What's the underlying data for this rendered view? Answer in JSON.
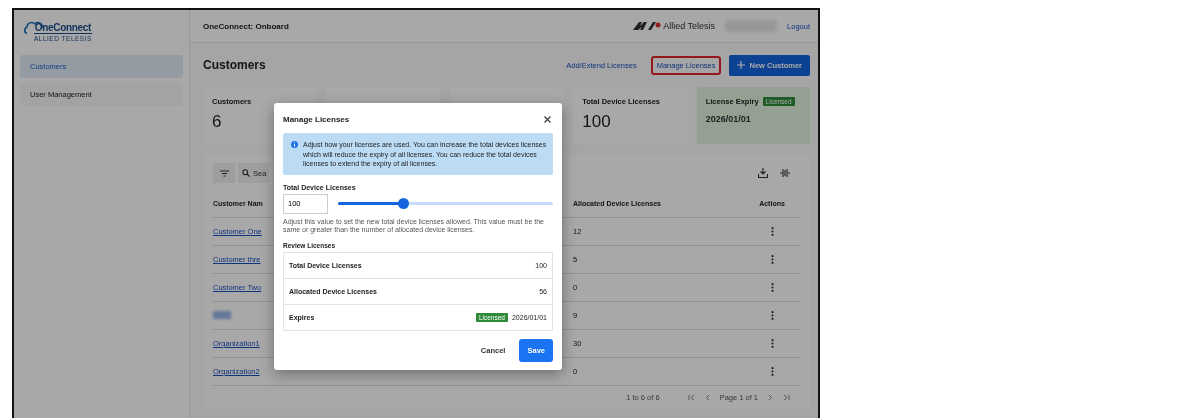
{
  "sidebar": {
    "logo": {
      "name": "OneConnect",
      "tagline": "ALLIED TELESIS"
    },
    "items": [
      {
        "label": "Customers",
        "selected": true
      },
      {
        "label": "User Management",
        "selected": false
      }
    ]
  },
  "header": {
    "title": "OneConnect: Onboard",
    "brand": "Allied Telesis",
    "logout": "Logout"
  },
  "page": {
    "title": "Customers",
    "actions": [
      {
        "kind": "link",
        "label": "Add/Extend Licenses",
        "highlighted": false
      },
      {
        "kind": "link",
        "label": "Manage Licenses",
        "highlighted": true
      },
      {
        "kind": "primary",
        "label": "New Customer"
      }
    ]
  },
  "cards": [
    {
      "kind": "plain",
      "label": "Customers",
      "value": "6"
    },
    {
      "kind": "plain"
    },
    {
      "kind": "plain"
    },
    {
      "kind": "plain",
      "label": "Total Device Licenses",
      "value": "100"
    },
    {
      "kind": "expiry",
      "label": "License Expiry",
      "badge": "Licensed",
      "value": "2026/01/01"
    }
  ],
  "table": {
    "search": {
      "placeholder": "Sea"
    },
    "columns": [
      "Customer Nam",
      "Allocated Device Licenses",
      "Actions"
    ],
    "rows": [
      {
        "name": "Customer One",
        "allocated": "12",
        "blurred": false
      },
      {
        "name": "Customer thre",
        "allocated": "5",
        "blurred": false
      },
      {
        "name": "Customer Two",
        "allocated": "0",
        "blurred": false
      },
      {
        "blurred": true,
        "allocated": "9"
      },
      {
        "name": "Organization1",
        "allocated": "30",
        "blurred": false
      },
      {
        "name": "Organization2",
        "allocated": "0",
        "blurred": false
      }
    ],
    "pagination": {
      "range": "1 to 6 of 6",
      "page": "Page 1 of 1"
    }
  },
  "dialog": {
    "title": "Manage Licenses",
    "info": "Adjust how your licenses are used. You can increase the total devices licenses which will reduce the expiry of all licenses. You can reduce the total devices licenses to extend the expiry of all licenses.",
    "field_label": "Total Device Licenses",
    "field_value": "100",
    "level": 0.3,
    "hint": "Adjust this value to set the new total device licenses allowed. This value must be the same or greater than the number of allocated device licenses.",
    "review_title": "Review Licenses",
    "review": [
      {
        "label": "Total Device Licenses",
        "value": "100"
      },
      {
        "label": "Allocated Device Licenses",
        "value": "56"
      },
      {
        "label": "Expires",
        "badge": "Licensed",
        "value": "2026/01/01"
      }
    ],
    "buttons": [
      {
        "kind": "text",
        "label": "Cancel"
      },
      {
        "kind": "primary",
        "label": "Save"
      }
    ]
  }
}
